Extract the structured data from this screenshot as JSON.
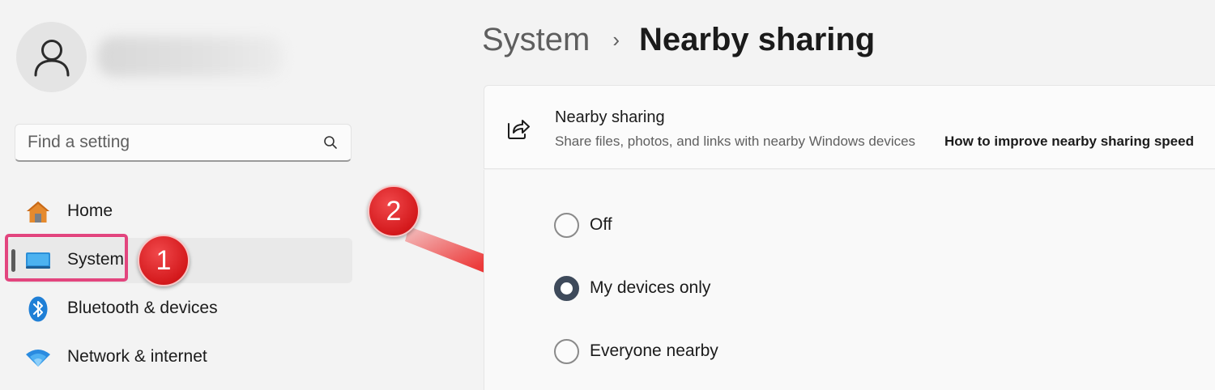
{
  "sidebar": {
    "search": {
      "placeholder": "Find a setting"
    },
    "nav": [
      {
        "id": "home",
        "label": "Home",
        "icon": "home-icon"
      },
      {
        "id": "system",
        "label": "System",
        "icon": "display-icon",
        "selected": true
      },
      {
        "id": "bluetooth",
        "label": "Bluetooth & devices",
        "icon": "bluetooth-icon"
      },
      {
        "id": "network",
        "label": "Network & internet",
        "icon": "wifi-icon"
      }
    ]
  },
  "annotations": {
    "step1": "1",
    "step2": "2",
    "highlight_color": "#e2457e",
    "badge_color": "#d4191c"
  },
  "breadcrumb": {
    "parent": "System",
    "separator": "›",
    "current": "Nearby sharing"
  },
  "card": {
    "icon": "share-icon",
    "title": "Nearby sharing",
    "description": "Share files, photos, and links with nearby Windows devices",
    "link": "How to improve nearby sharing speed"
  },
  "options": [
    {
      "label": "Off",
      "checked": false
    },
    {
      "label": "My devices only",
      "checked": true
    },
    {
      "label": "Everyone nearby",
      "checked": false
    }
  ],
  "colors": {
    "accent_radio": "#3e4a5b",
    "window_bg": "#f3f3f3"
  }
}
